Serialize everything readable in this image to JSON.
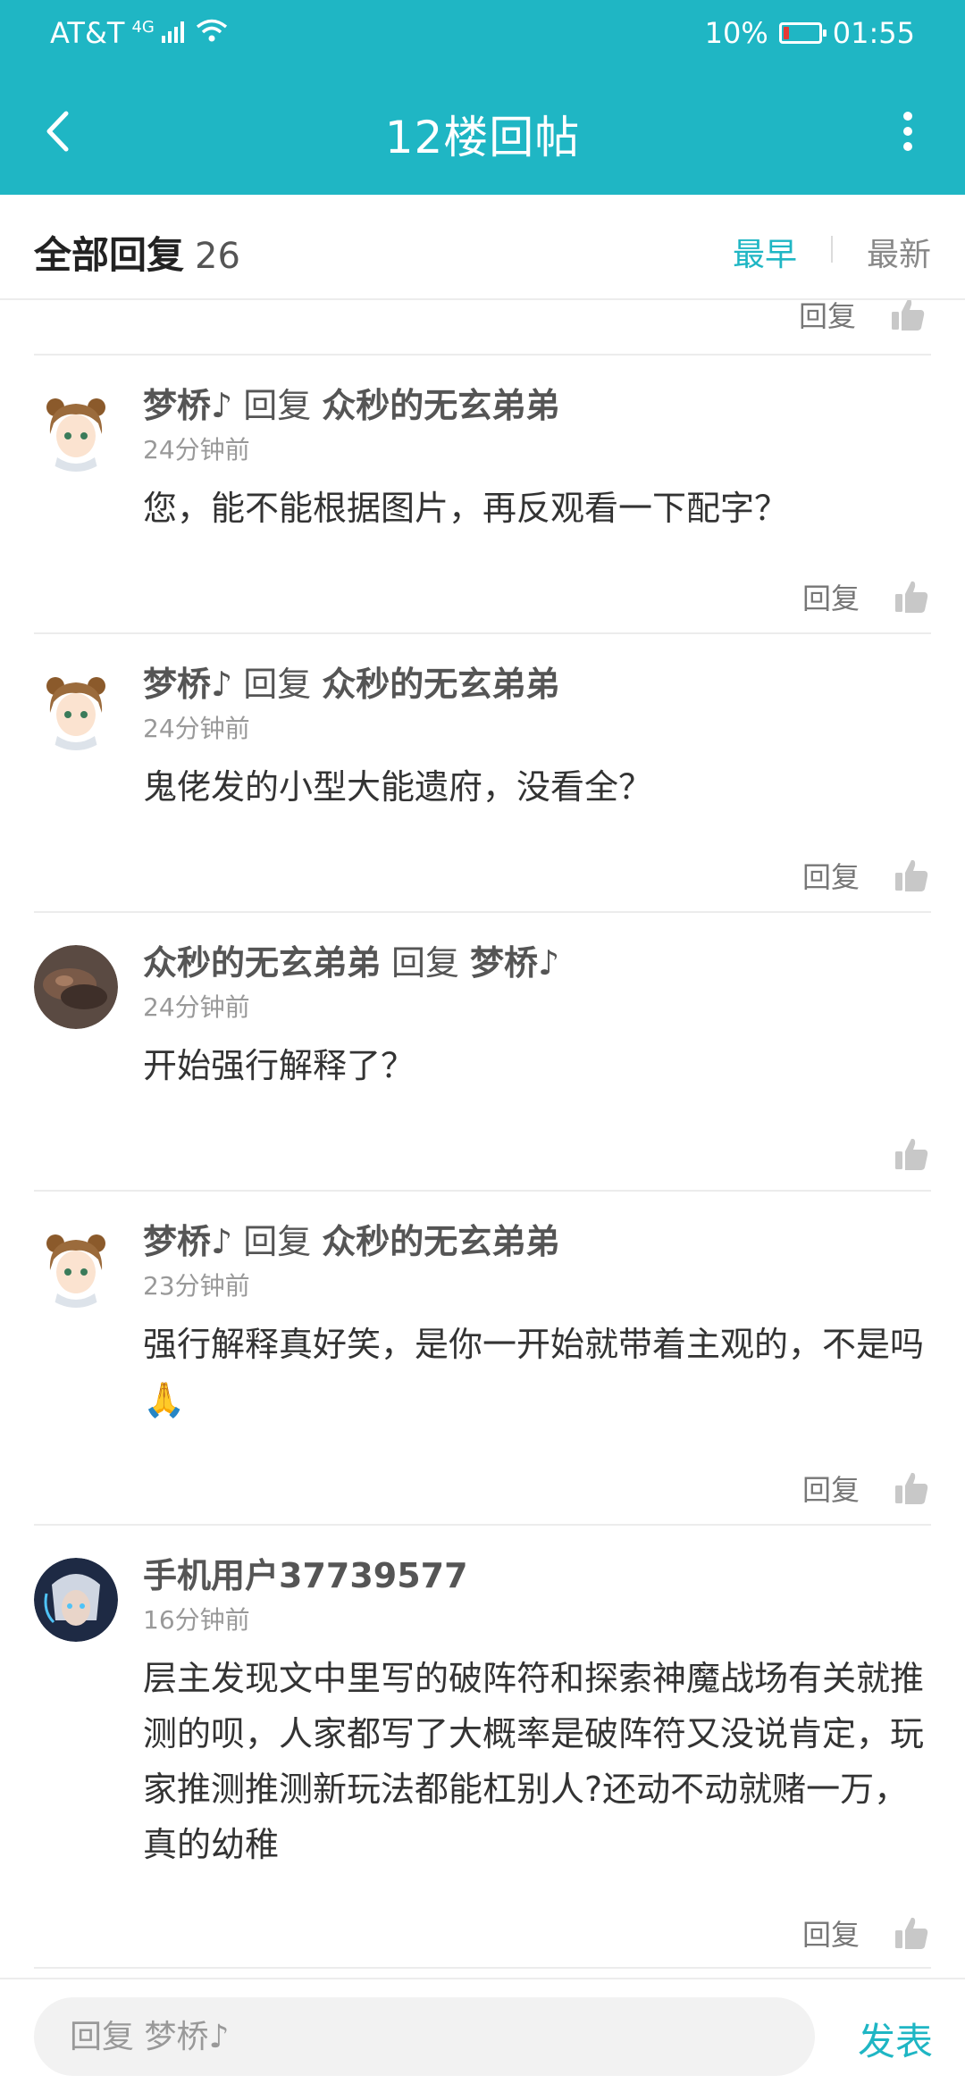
{
  "status": {
    "carrier": "AT&T",
    "network": "4G",
    "battery": "10%",
    "time": "01:55"
  },
  "nav": {
    "title": "12楼回帖"
  },
  "sort": {
    "label": "全部回复",
    "count": "26",
    "earliest": "最早",
    "latest": "最新"
  },
  "actions": {
    "reply": "回复"
  },
  "replies": [
    {
      "author": "梦桥♪",
      "reply_word": "回复",
      "target": "众秒的无玄弟弟",
      "time": "24分钟前",
      "content": "您，能不能根据图片，再反观看一下配字？"
    },
    {
      "author": "梦桥♪",
      "reply_word": "回复",
      "target": "众秒的无玄弟弟",
      "time": "24分钟前",
      "content": "鬼佬发的小型大能遗府，没看全？"
    },
    {
      "author": "众秒的无玄弟弟",
      "reply_word": "回复",
      "target": "梦桥♪",
      "time": "24分钟前",
      "content": "开始强行解释了？"
    },
    {
      "author": "梦桥♪",
      "reply_word": "回复",
      "target": "众秒的无玄弟弟",
      "time": "23分钟前",
      "content": "强行解释真好笑，是你一开始就带着主观的，不是吗🙏"
    },
    {
      "author": "手机用户37739577",
      "time": "16分钟前",
      "content": "层主发现文中里写的破阵符和探索神魔战场有关就推测的呗，人家都写了大概率是破阵符又没说肯定，玩家推测推测新玩法都能杠别人?还动不动就赌一万，真的幼稚"
    }
  ],
  "composer": {
    "placeholder": "回复 梦桥♪",
    "send": "发表"
  },
  "colors": {
    "accent": "#1fb6c4",
    "battery_low": "#e53935"
  }
}
